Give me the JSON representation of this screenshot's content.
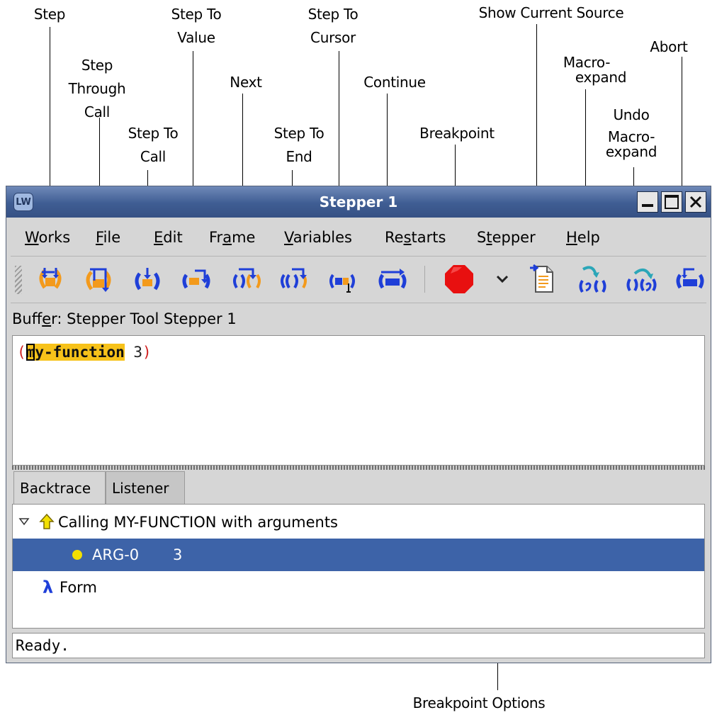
{
  "callouts": {
    "step": [
      "Step"
    ],
    "step_through_call": [
      "Step",
      "Through",
      "Call"
    ],
    "step_to_call": [
      "Step To",
      "Call"
    ],
    "step_to_value": [
      "Step To",
      "Value"
    ],
    "next": [
      "Next"
    ],
    "step_to_end": [
      "Step To",
      "End"
    ],
    "step_to_cursor": [
      "Step To",
      "Cursor"
    ],
    "continue": [
      "Continue"
    ],
    "breakpoint": [
      "Breakpoint"
    ],
    "show_current_source": [
      "Show Current Source"
    ],
    "macroexpand": [
      "Macro-",
      "expand"
    ],
    "undo_macroexpand": [
      "Undo",
      "Macro-",
      "expand"
    ],
    "abort": [
      "Abort"
    ],
    "breakpoint_options": [
      "Breakpoint Options"
    ]
  },
  "window": {
    "title": "Stepper 1",
    "app_icon_label": "LW",
    "controls": {
      "minimize": "minimize-icon",
      "maximize": "maximize-icon",
      "close": "close-icon"
    }
  },
  "menubar": [
    {
      "key": "W",
      "rest": "orks"
    },
    {
      "key": "F",
      "rest": "ile"
    },
    {
      "key": "E",
      "rest": "dit"
    },
    {
      "pre": "Fr",
      "key": "a",
      "rest": "me"
    },
    {
      "key": "V",
      "rest": "ariables"
    },
    {
      "pre": "Re",
      "key": "s",
      "rest": "tarts"
    },
    {
      "pre": "S",
      "key": "t",
      "rest": "epper"
    },
    {
      "key": "H",
      "rest": "elp"
    }
  ],
  "toolbar": {
    "step": {
      "icon": "step-icon"
    },
    "step_through_call": {
      "icon": "step-through-call-icon"
    },
    "step_to_call": {
      "icon": "step-to-call-icon"
    },
    "step_to_value": {
      "icon": "step-to-value-icon"
    },
    "next": {
      "icon": "next-icon"
    },
    "step_to_end": {
      "icon": "step-to-end-icon"
    },
    "step_to_cursor": {
      "icon": "step-to-cursor-icon"
    },
    "continue": {
      "icon": "continue-icon"
    },
    "breakpoint": {
      "icon": "breakpoint-icon",
      "color": "#e81010"
    },
    "breakpoint_options": {
      "icon": "chevron-down-icon"
    },
    "show_current_source": {
      "icon": "show-source-icon"
    },
    "macroexpand": {
      "icon": "macroexpand-icon"
    },
    "undo_macroexpand": {
      "icon": "undo-macroexpand-icon"
    },
    "abort": {
      "icon": "abort-icon"
    }
  },
  "buffer": {
    "pre": "Buff",
    "key": "e",
    "rest": "r: Stepper Tool Stepper 1"
  },
  "editor": {
    "open_paren": "(",
    "cursor_char": "m",
    "highlighted": "y-function",
    "after": " 3",
    "close_paren": ")"
  },
  "tabs": [
    {
      "label": "Backtrace",
      "active": true
    },
    {
      "label": "Listener",
      "active": false
    }
  ],
  "tree": {
    "rows": [
      {
        "text": "Calling MY-FUNCTION with arguments",
        "expanded": true,
        "icon": "up-arrow-icon"
      },
      {
        "name": "ARG-0",
        "value": "3",
        "icon": "bullet-icon",
        "selected": true
      },
      {
        "text": "Form",
        "icon": "lambda-icon"
      }
    ]
  },
  "status": "Ready.",
  "colors": {
    "title_bar": "#3f5d93",
    "selection": "#3d63a8",
    "highlight": "#f7c21a",
    "icon_blue": "#1f3fd8",
    "icon_orange": "#f39a1c",
    "icon_teal": "#2aa6b8"
  }
}
